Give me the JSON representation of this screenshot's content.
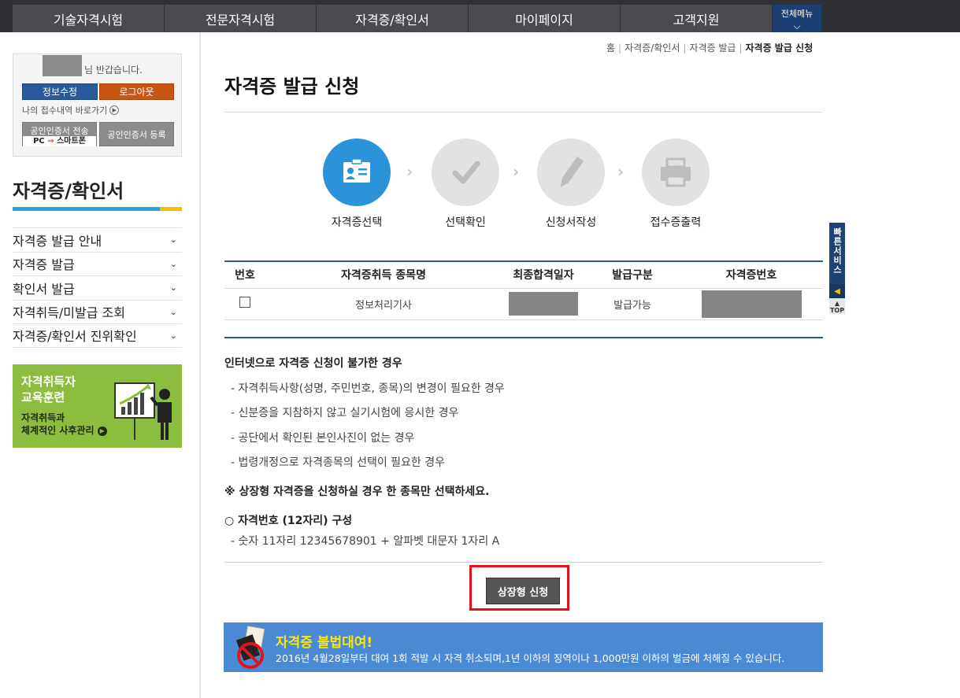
{
  "nav": {
    "items": [
      "기술자격시험",
      "전문자격시험",
      "자격증/확인서",
      "마이페이지",
      "고객지원"
    ],
    "all_menu": "전체메뉴"
  },
  "login": {
    "greeting": "님 반갑습니다.",
    "edit_label": "정보수정",
    "logout_label": "로그아웃",
    "my_records": "나의 접수내역 바로가기",
    "cert_send_label": "공인인증서 전송",
    "cert_send_sub_left": "PC",
    "cert_send_sub_right": "스마트폰",
    "cert_register_label": "공인인증서 등록"
  },
  "sidebar": {
    "title": "자격증/확인서",
    "items": [
      {
        "label": "자격증 발급 안내"
      },
      {
        "label": "자격증 발급"
      },
      {
        "label": "확인서 발급"
      },
      {
        "label": "자격취득/미발급 조회"
      },
      {
        "label": "자격증/확인서 진위확인"
      }
    ],
    "banner": {
      "line1": "자격취득자",
      "line2": "교육훈련",
      "line3": "자격취득과",
      "line4": "체계적인 사후관리"
    }
  },
  "breadcrumb": [
    "홈",
    "자격증/확인서",
    "자격증 발급",
    "자격증 발급 신청"
  ],
  "page_title": "자격증 발급 신청",
  "steps": [
    {
      "label": "자격증선택",
      "icon": "id-card-icon",
      "active": true
    },
    {
      "label": "선택확인",
      "icon": "checkmark-icon",
      "active": false
    },
    {
      "label": "신청서작성",
      "icon": "pencil-icon",
      "active": false
    },
    {
      "label": "접수증출력",
      "icon": "printer-icon",
      "active": false
    }
  ],
  "table": {
    "headers": [
      "번호",
      "자격증취득 종목명",
      "최종합격일자",
      "발급구분",
      "자격증번호"
    ],
    "rows": [
      {
        "name": "정보처리기사",
        "status": "발급가능"
      }
    ]
  },
  "notice": {
    "heading": "인터넷으로 자격증 신청이 불가한 경우",
    "items": [
      "- 자격취득사항(성명, 주민번호, 종목)의 변경이 필요한 경우",
      "- 신분증을 지참하지 않고 실기시험에 응시한 경우",
      "- 공단에서 확인된 본인사진이 없는 경우",
      "- 법령개정으로 자격종목의 선택이 필요한 경우"
    ],
    "warning": "※ 상장형 자격증을 신청하실 경우 한 종목만 선택하세요.",
    "structure_heading": "○ 자격번호 (12자리) 구성",
    "structure_item": "- 숫자 11자리 12345678901 + 알파벳 대문자 1자리 A"
  },
  "apply_button": "상장형 신청",
  "bottom_banner": {
    "title": "자격증 불법대여!",
    "desc": "2016년 4월28일부터 대여 1회 적발 시 자격 취소되며,1년 이하의 징역이나 1,000만원 이하의 벌금에 처해질 수 있습니다."
  },
  "quick": {
    "label": "빠른서비스",
    "top": "TOP"
  },
  "colors": {
    "nav_bg": "#2f3033",
    "accent_blue": "#2b94d8",
    "highlight_red": "#e0141d"
  }
}
